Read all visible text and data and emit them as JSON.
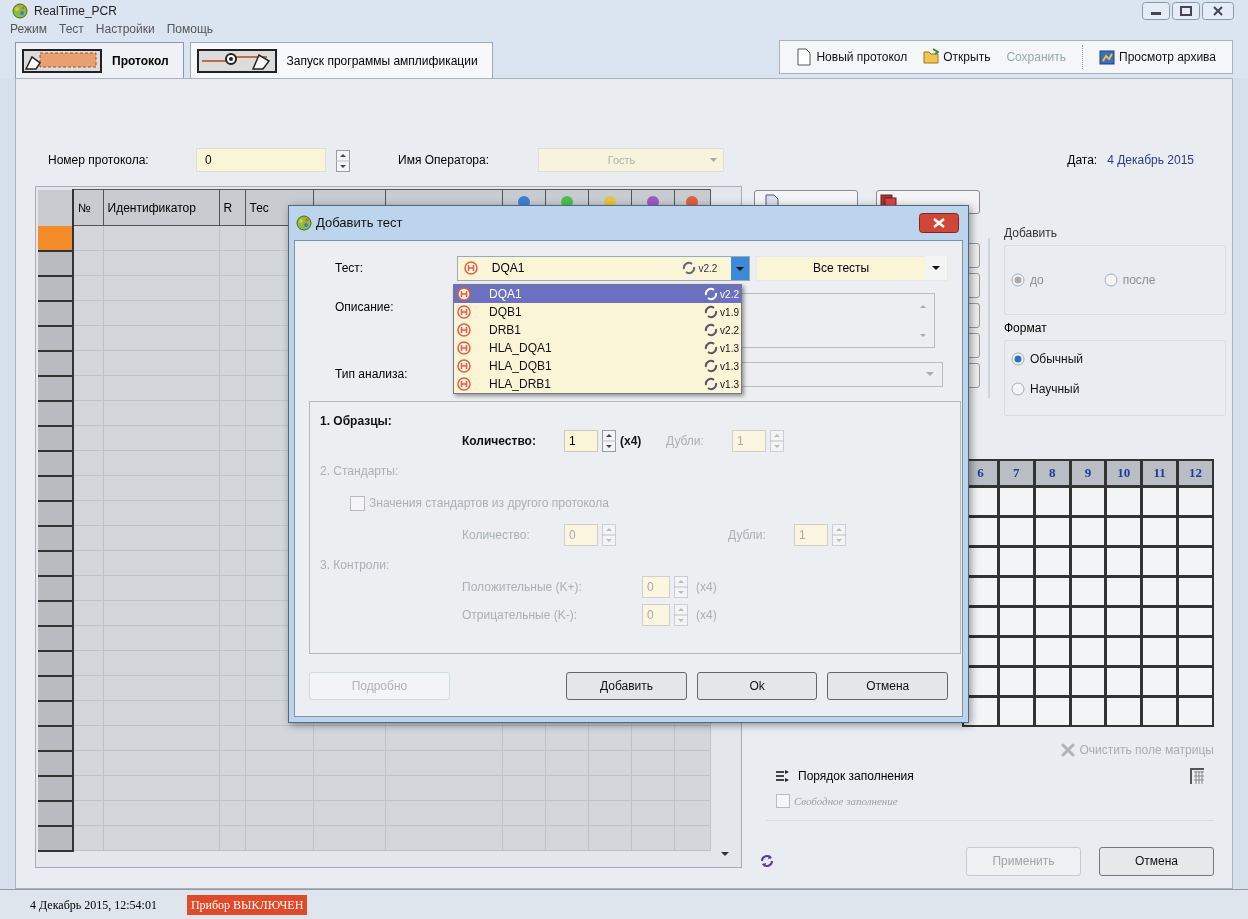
{
  "window": {
    "title": "RealTime_PCR"
  },
  "menu": [
    "Режим",
    "Тест",
    "Настройки",
    "Помощь"
  ],
  "tabs": [
    {
      "label": "Протокол",
      "selected": true
    },
    {
      "label": "Запуск программы амплификации",
      "selected": false
    }
  ],
  "toolbar": [
    {
      "label": "Новый протокол",
      "kind": "new",
      "disabled": false
    },
    {
      "label": "Открыть",
      "kind": "open",
      "disabled": false
    },
    {
      "label": "Сохранить",
      "kind": "save",
      "disabled": true
    },
    {
      "label": "Просмотр архива",
      "kind": "archive",
      "disabled": false
    }
  ],
  "protocol": {
    "number_label": "Номер протокола:",
    "number": "0",
    "operator_label": "Имя Оператора:",
    "operator": "Гость",
    "date_label": "Дата:",
    "date": "4 Декабрь 2015"
  },
  "table": {
    "columns": [
      "№",
      "Идентификатор",
      "R",
      "Тес"
    ],
    "dye_columns": [
      {
        "color": "#3b7fd6"
      },
      {
        "color": "#4cbf4c"
      },
      {
        "color": "#e8c43a"
      },
      {
        "color": "#9b59c9"
      },
      {
        "color": "#e0603a"
      }
    ],
    "rows": [
      {
        "selected": true
      },
      {
        "selected": false
      },
      {
        "selected": false
      },
      {
        "selected": false
      },
      {
        "selected": false
      },
      {
        "selected": false
      },
      {
        "selected": false
      },
      {
        "selected": false
      },
      {
        "selected": false
      },
      {
        "selected": false
      },
      {
        "selected": false
      },
      {
        "selected": false
      },
      {
        "selected": false
      },
      {
        "selected": false
      },
      {
        "selected": false
      },
      {
        "selected": false
      },
      {
        "selected": false
      },
      {
        "selected": false
      },
      {
        "selected": false
      },
      {
        "selected": false
      },
      {
        "selected": false
      },
      {
        "selected": false
      },
      {
        "selected": false
      },
      {
        "selected": false
      },
      {
        "selected": false
      }
    ]
  },
  "add_position": {
    "title": "Добавить",
    "disabled": true,
    "options": [
      {
        "label": "до",
        "selected": true
      },
      {
        "label": "после",
        "selected": false
      }
    ]
  },
  "format": {
    "title": "Формат",
    "disabled": false,
    "options": [
      {
        "label": "Обычный",
        "selected": true
      },
      {
        "label": "Научный",
        "selected": false
      }
    ]
  },
  "plate": {
    "columns": [
      "6",
      "7",
      "8",
      "9",
      "10",
      "11",
      "12"
    ]
  },
  "clear_matrix": {
    "label": "Очистить поле матрицы",
    "disabled": true
  },
  "fill_order": {
    "label": "Порядок заполнения"
  },
  "free_fill": {
    "label": "Свободное заполнение",
    "checked": false,
    "disabled": true
  },
  "apply_button": {
    "label": "Применить",
    "disabled": true
  },
  "cancel_button": {
    "label": "Отмена",
    "disabled": false
  },
  "status_bar": {
    "datetime": "4 Декабрь 2015, 12:54:01",
    "device_status": "Прибор ВЫКЛЮЧЕН"
  },
  "dialog": {
    "title": "Добавить тест",
    "test_label": "Тест:",
    "test": {
      "name": "DQA1",
      "version": "v2.2"
    },
    "filter": "Все тесты",
    "description_label": "Описание:",
    "analysis_label": "Тип анализа:",
    "dropdown": [
      {
        "name": "DQA1",
        "version": "v2.2",
        "selected": true
      },
      {
        "name": "DQB1",
        "version": "v1.9",
        "selected": false
      },
      {
        "name": "DRB1",
        "version": "v2.2",
        "selected": false
      },
      {
        "name": "HLA_DQA1",
        "version": "v1.3",
        "selected": false
      },
      {
        "name": "HLA_DQB1",
        "version": "v1.3",
        "selected": false
      },
      {
        "name": "HLA_DRB1",
        "version": "v1.3",
        "selected": false
      }
    ],
    "samples": {
      "title": "1. Образцы:",
      "disabled": false,
      "count_label": "Количество:",
      "count": "1",
      "multiplier": "(x4)",
      "dup_label": "Дубли:",
      "dup": "1"
    },
    "standards": {
      "title": "2. Стандарты:",
      "disabled": true,
      "checkbox_label": "Значения стандартов из другого протокола",
      "checked": false,
      "count_label": "Количество:",
      "count": "0",
      "dup_label": "Дубли:",
      "dup": "1"
    },
    "controls": {
      "title": "3. Контроли:",
      "disabled": true,
      "items": [
        {
          "label": "Положительные (K+):",
          "value": "0",
          "multiplier": "(x4)"
        },
        {
          "label": "Отрицательные (K-):",
          "value": "0",
          "multiplier": "(x4)"
        }
      ]
    },
    "buttons": [
      {
        "label": "Подробно",
        "disabled": true
      },
      {
        "label": "Добавить",
        "disabled": false
      },
      {
        "label": "Ok",
        "disabled": false
      },
      {
        "label": "Отмена",
        "disabled": false
      }
    ]
  }
}
